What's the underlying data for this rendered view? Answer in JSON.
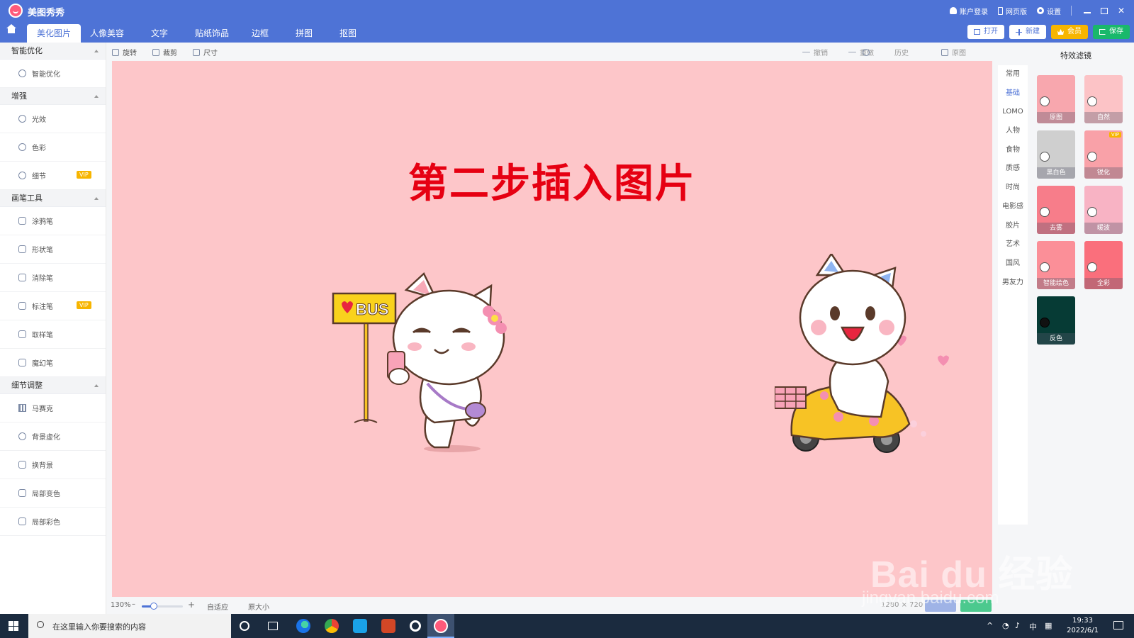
{
  "app": {
    "name": "美图秀秀",
    "account_login": "账户登录",
    "web_version": "网页版",
    "settings": "设置"
  },
  "tabs": [
    {
      "label": "美化图片",
      "active": true
    },
    {
      "label": "人像美容"
    },
    {
      "label": "文字"
    },
    {
      "label": "贴纸饰品"
    },
    {
      "label": "边框"
    },
    {
      "label": "拼图"
    },
    {
      "label": "抠图"
    }
  ],
  "actions": {
    "open": "打开",
    "new": "新建",
    "vip": "会员",
    "save": "保存"
  },
  "sidebar": {
    "sections": [
      {
        "title": "智能优化",
        "items": [
          {
            "label": "智能优化"
          }
        ]
      },
      {
        "title": "增强",
        "items": [
          {
            "label": "光效"
          },
          {
            "label": "色彩"
          },
          {
            "label": "细节",
            "vip": "VIP"
          }
        ]
      },
      {
        "title": "画笔工具",
        "items": [
          {
            "label": "涂鸦笔"
          },
          {
            "label": "形状笔"
          },
          {
            "label": "消除笔"
          },
          {
            "label": "标注笔",
            "vip": "VIP"
          },
          {
            "label": "取样笔"
          },
          {
            "label": "魔幻笔"
          }
        ]
      },
      {
        "title": "细节调整",
        "items": [
          {
            "label": "马赛克"
          },
          {
            "label": "背景虚化"
          },
          {
            "label": "换背景"
          },
          {
            "label": "局部变色"
          },
          {
            "label": "局部彩色"
          }
        ]
      }
    ]
  },
  "toolbar": {
    "rotate": "旋转",
    "crop": "裁剪",
    "size": "尺寸",
    "undo": "撤销",
    "redo": "重做",
    "history": "历史",
    "original": "原图"
  },
  "canvas": {
    "title": "第二步插入图片",
    "sign_text": "BUS",
    "background": "#fdc6c9"
  },
  "status": {
    "zoom": "130%",
    "fit": "自适应",
    "original_size": "原大小",
    "image_size": "1280 × 720"
  },
  "filters": {
    "title": "特效滤镜",
    "categories": [
      "常用",
      "基础",
      "LOMO",
      "人物",
      "食物",
      "质感",
      "时尚",
      "电影感",
      "胶片",
      "艺术",
      "国风",
      "男友力"
    ],
    "active_category": "基础",
    "items": [
      {
        "label": "原图",
        "color": "#f8a7ae"
      },
      {
        "label": "自然",
        "color": "#fcc3c6"
      },
      {
        "label": "黑白色",
        "color": "#cfcfcf"
      },
      {
        "label": "锐化",
        "color": "#f9a1a8",
        "vip": "VIP"
      },
      {
        "label": "去雾",
        "color": "#f77d8a"
      },
      {
        "label": "暖波",
        "color": "#f8b3c4"
      },
      {
        "label": "智能绘色",
        "color": "#fb8f98"
      },
      {
        "label": "全彩",
        "color": "#fa6f7c"
      },
      {
        "label": "反色",
        "color": "#063b35"
      }
    ]
  },
  "taskbar": {
    "search_placeholder": "在这里输入你要搜索的内容",
    "ime": "中",
    "time": "19:33",
    "date": "2022/6/1"
  },
  "watermark": {
    "main": "Bai du 经验",
    "sub": "jingyan.baidu.com"
  }
}
